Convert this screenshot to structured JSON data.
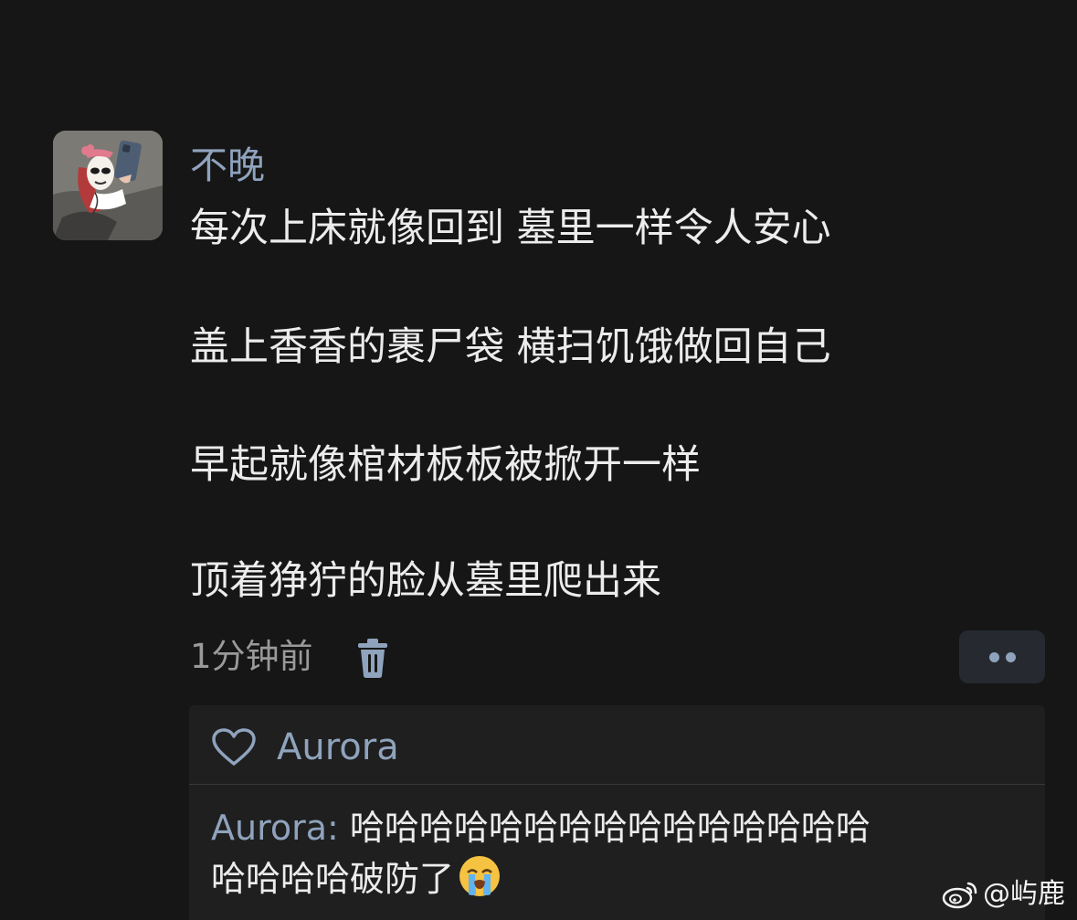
{
  "post": {
    "username": "不晚",
    "lines": [
      "每次上床就像回到 墓里一样令人安心",
      "盖上香香的裹尸袋 横扫饥饿做回自己",
      "早起就像棺材板板被掀开一样",
      "顶着狰狞的脸从墓里爬出来"
    ],
    "time": "1分钟前"
  },
  "icons": {
    "avatar": "avatar-illustration",
    "trash": "trash-icon",
    "more": "more-dots-icon",
    "heart": "heart-outline-icon",
    "crying_emoji": "loudly-crying-face-icon",
    "watermark_logo": "weibo-logo-icon"
  },
  "reactions": {
    "liker": "Aurora"
  },
  "reply": {
    "author": "Aurora:",
    "line1": " 哈哈哈哈哈哈哈哈哈哈哈哈哈哈哈",
    "line2": "哈哈哈哈破防了"
  },
  "watermark": {
    "text": "@屿鹿"
  },
  "colors": {
    "background": "#161616",
    "accent": "#8fa3bd",
    "text": "#ececec",
    "muted": "#9a9a9a",
    "reply_box": "#1f1f1f"
  }
}
